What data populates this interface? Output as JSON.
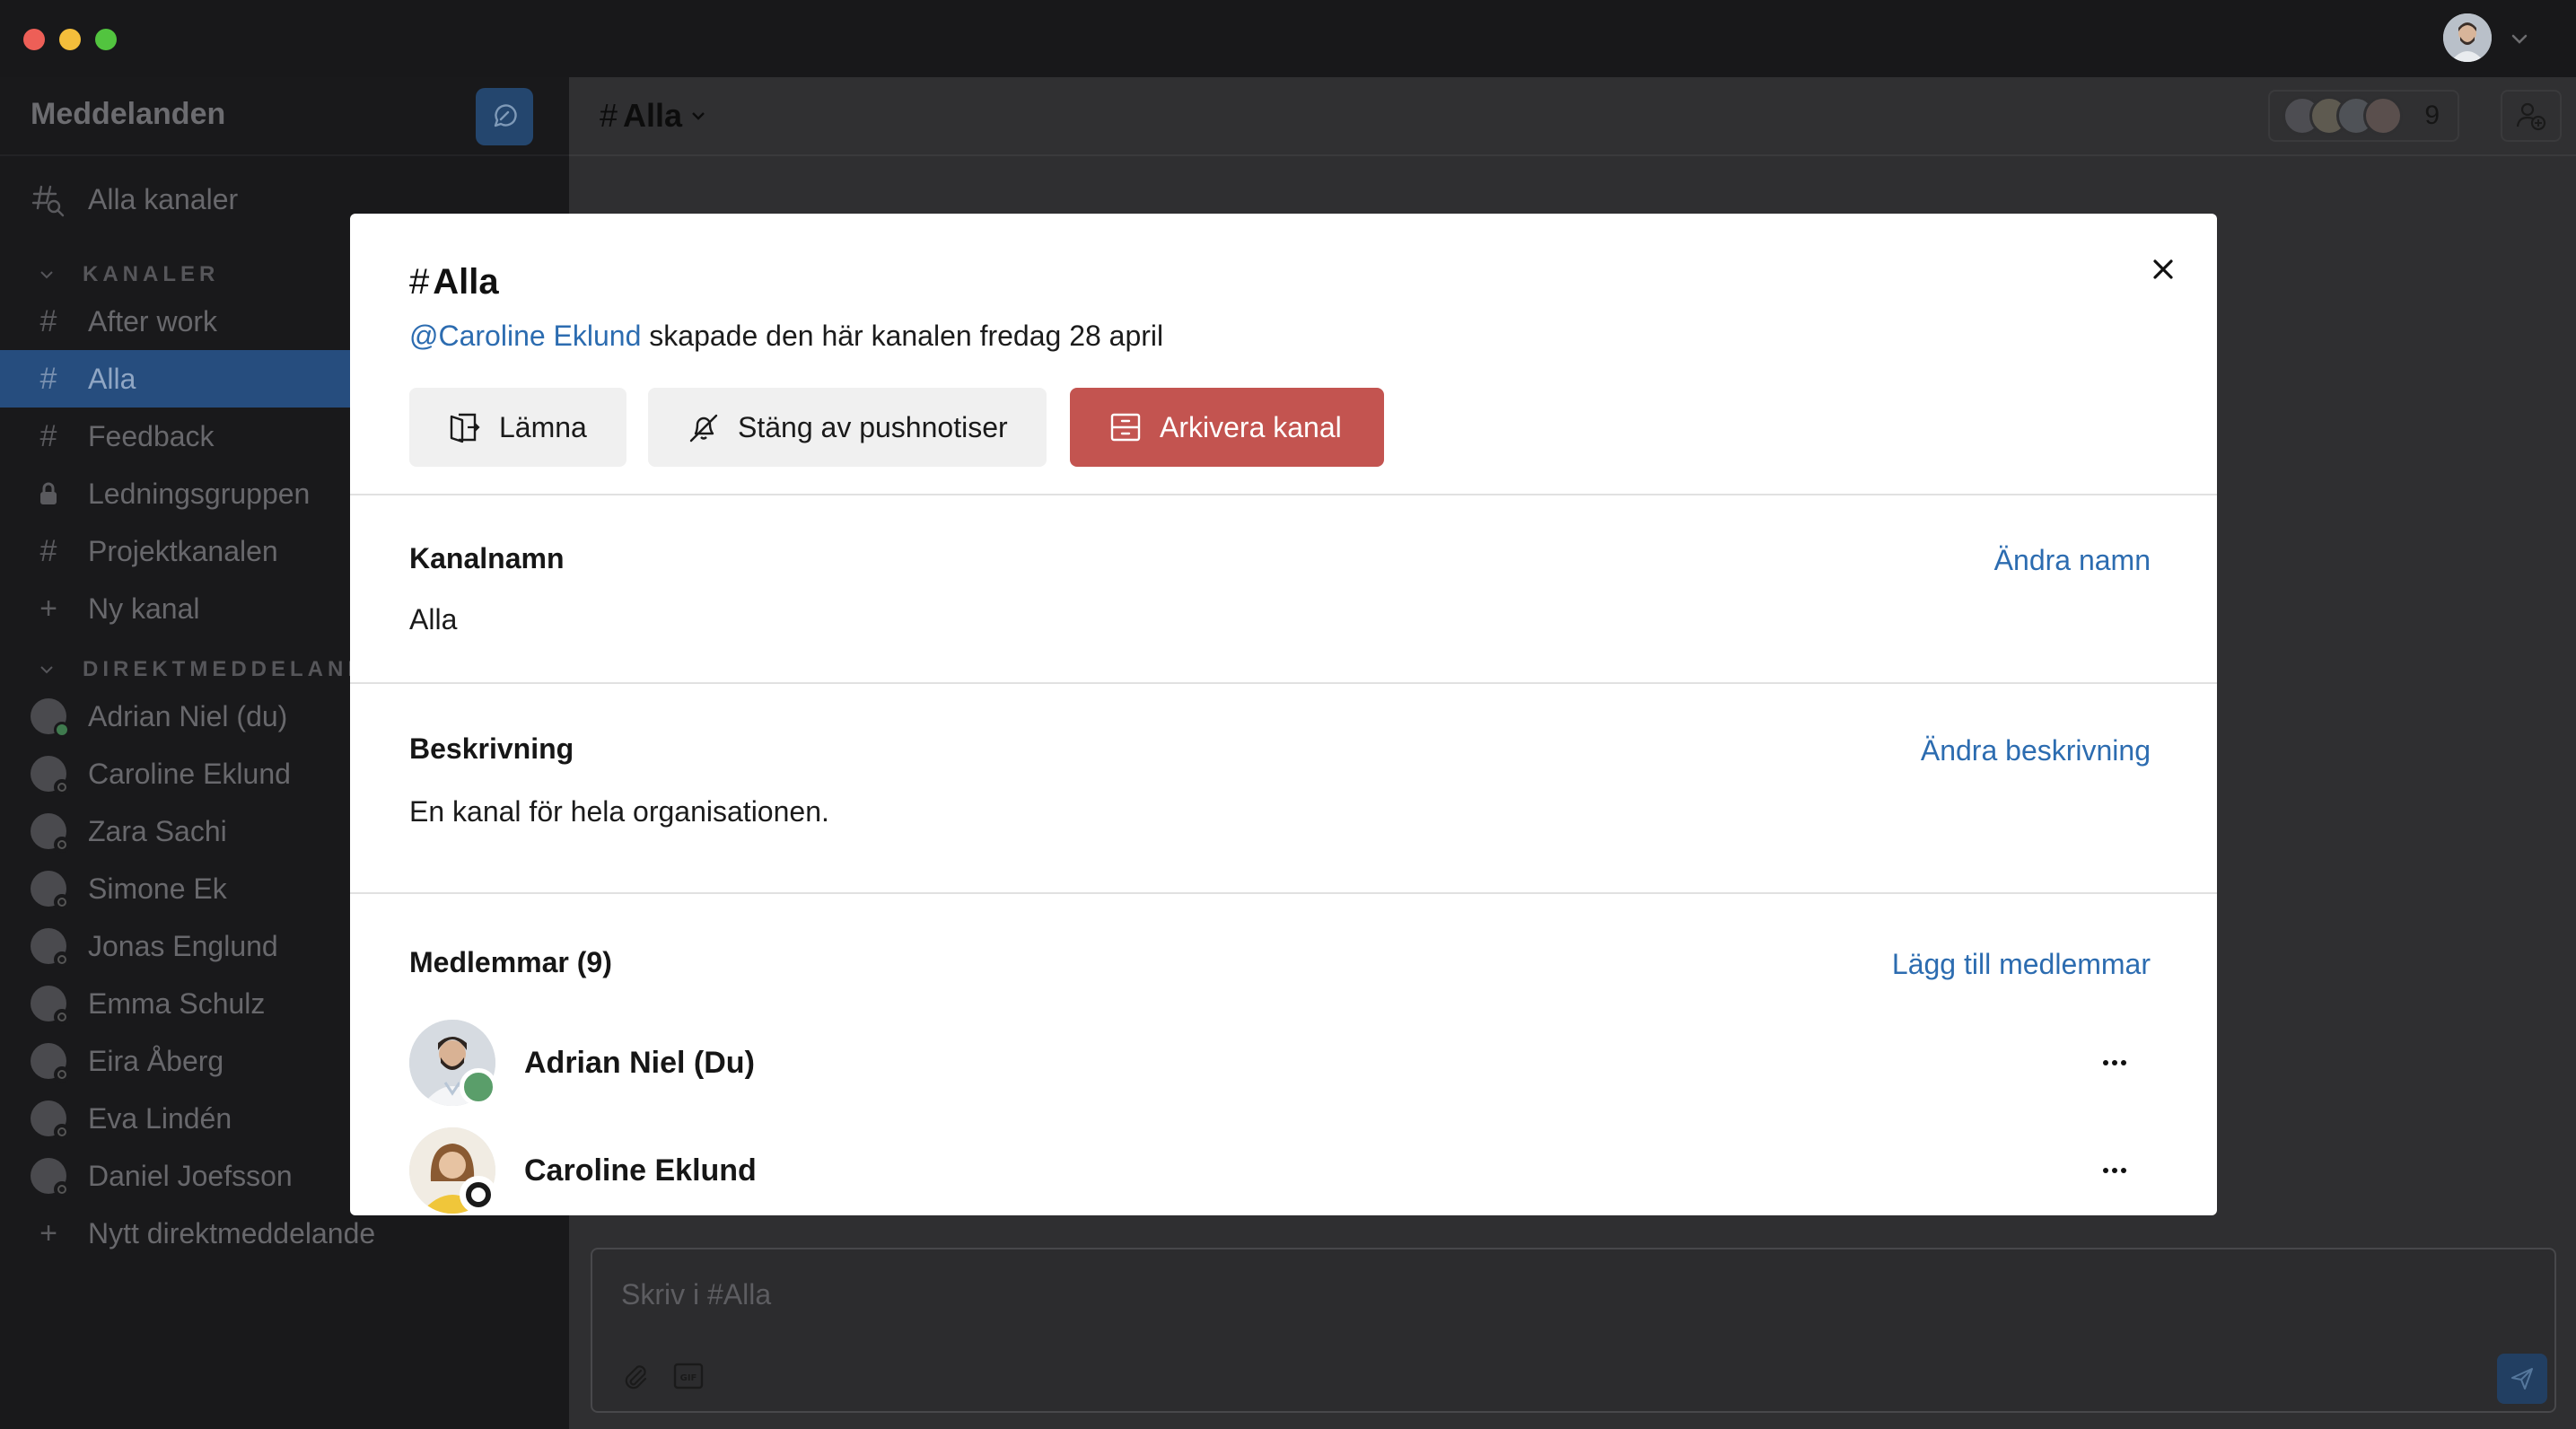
{
  "sidebar": {
    "title": "Meddelanden",
    "all_channels": "Alla kanaler",
    "channels_section": "KANALER",
    "channels": [
      {
        "label": "After work",
        "icon": "hash-icon",
        "active": false
      },
      {
        "label": "Alla",
        "icon": "hash-icon",
        "active": true
      },
      {
        "label": "Feedback",
        "icon": "hash-icon",
        "active": false
      },
      {
        "label": "Ledningsgruppen",
        "icon": "lock-icon",
        "active": false
      },
      {
        "label": "Projektkanalen",
        "icon": "hash-icon",
        "active": false
      }
    ],
    "new_channel": "Ny kanal",
    "dm_section": "DIREKTMEDDELANDEN",
    "dms": [
      {
        "label": "Adrian Niel (du)",
        "status": "online"
      },
      {
        "label": "Caroline Eklund",
        "status": "offline"
      },
      {
        "label": "Zara Sachi",
        "status": "offline"
      },
      {
        "label": "Simone Ek",
        "status": "offline"
      },
      {
        "label": "Jonas Englund",
        "status": "offline"
      },
      {
        "label": "Emma Schulz",
        "status": "offline"
      },
      {
        "label": "Eira Åberg",
        "status": "offline"
      },
      {
        "label": "Eva Lindén",
        "status": "offline"
      },
      {
        "label": "Daniel Joefsson",
        "status": "offline"
      }
    ],
    "new_dm": "Nytt direktmeddelande"
  },
  "header": {
    "hash": "#",
    "channel": "Alla",
    "member_count": "9"
  },
  "composer": {
    "placeholder": "Skriv i #Alla"
  },
  "modal": {
    "hash": "#",
    "title": "Alla",
    "creator": "@Caroline Eklund",
    "created_text": " skapade den här kanalen fredag 28 april",
    "buttons": {
      "leave": "Lämna",
      "mute": "Stäng av pushnotiser",
      "archive": "Arkivera kanal"
    },
    "name_section": {
      "label": "Kanalnamn",
      "value": "Alla",
      "link": "Ändra namn"
    },
    "desc_section": {
      "label": "Beskrivning",
      "value": "En kanal för hela organisationen.",
      "link": "Ändra beskrivning"
    },
    "members_section": {
      "label": "Medlemmar (9)",
      "link": "Lägg till medlemmar",
      "members": [
        {
          "name": "Adrian Niel (Du)",
          "status": "online"
        },
        {
          "name": "Caroline Eklund",
          "status": "offline"
        }
      ]
    }
  },
  "colors": {
    "sidebar_active": "#264d7e",
    "link": "#2c6cb0",
    "archive_button": "#c35450",
    "online": "#5a9e6a"
  }
}
